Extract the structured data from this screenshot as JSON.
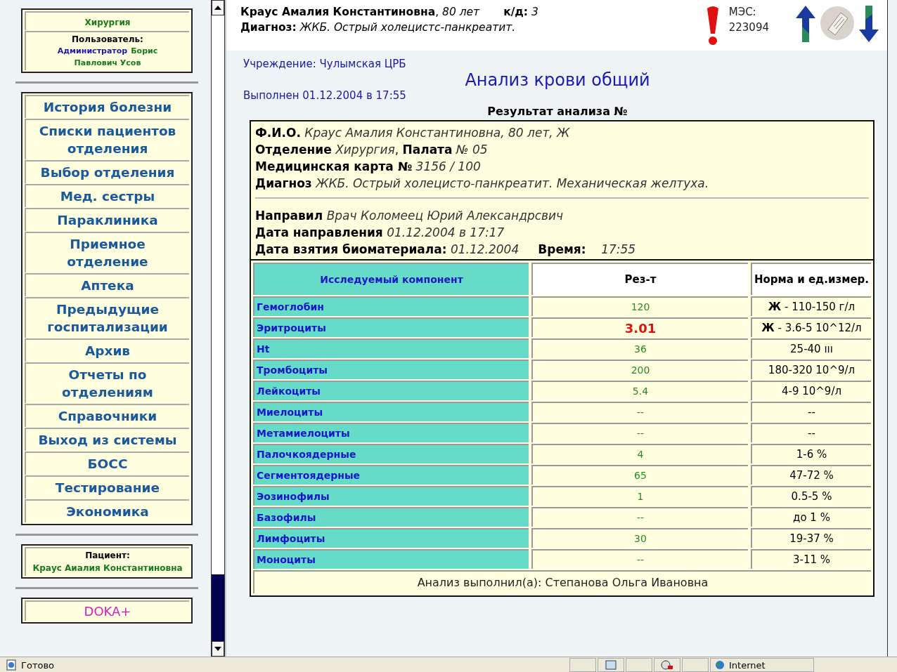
{
  "sidebar": {
    "department": "Хирургия",
    "user_label": "Пользователь:",
    "user_role": "Администратор",
    "user_name": "Борис Павлович Усов",
    "nav_items": [
      {
        "label": "История болезни"
      },
      {
        "label": "Списки пациентов отделения"
      },
      {
        "label": "Выбор отделения"
      },
      {
        "label": "Мед. сестры"
      },
      {
        "label": "Параклиника"
      },
      {
        "label": "Приемное отделение"
      },
      {
        "label": "Аптека"
      },
      {
        "label": "Предыдущие госпитализации"
      },
      {
        "label": "Архив"
      },
      {
        "label": "Отчеты по отделениям"
      },
      {
        "label": "Справочники"
      },
      {
        "label": "Выход из системы"
      },
      {
        "label": "БОСС"
      },
      {
        "label": "Тестирование"
      },
      {
        "label": "Экономика"
      }
    ],
    "patient_label": "Пациент:",
    "patient_name": "Краус Аиалия Константиновна",
    "brand": "DOKA+"
  },
  "header": {
    "patient": "**Краус Амалия Константиновна**, *80 лет*",
    "bed_days": "**к/д:** *3*",
    "diagnosis": "**Диагноз:** *ЖКБ. Острый холецистс-панкреатит.*",
    "mes_label": "МЭС:",
    "mes_code": "223094"
  },
  "report": {
    "institution": "Учреждение: Чулымская ЦРБ",
    "title": "Анализ крови общий",
    "performed": "Выполнен 01.12.2004 в 17:55",
    "result_title": "Результат анализа №",
    "info_lines": [
      "**Ф.И.О.** *Краус Амалия Константиновна, 80 лет, Ж*",
      "**Отделение** *Хирургия*, **Палата** *№ 05*",
      "**Медицинская карта №** *3156 / 100*",
      "**Диагноз** *ЖКБ. Острый холецисто-панкреатит. Механическая желтуха.*"
    ],
    "referral_lines": [
      "**Направил** *Врач Коломеец Юрий Александрсвич*",
      "**Дата направления** *01.12.2004 в 17:17*",
      "**Дата взятия биоматериала:** *01.12.2004*     **Время:**    *17:55*"
    ],
    "columns": [
      "Исследуемый компонент",
      "Рез-т",
      "Норма и ед.измер."
    ],
    "rows": [
      {
        "component": "Гемоглобин",
        "result": "120",
        "abnormal": false,
        "norm": "**Ж** - 110-150 г/л"
      },
      {
        "component": "Эритроциты",
        "result": "3.01",
        "abnormal": true,
        "norm": "**Ж** - 3.6-5 10^12/л"
      },
      {
        "component": "Ht",
        "result": "36",
        "abnormal": false,
        "norm": "25-40 ııı"
      },
      {
        "component": "Тромбоциты",
        "result": "200",
        "abnormal": false,
        "norm": "180-320 10^9/л"
      },
      {
        "component": "Лейкоциты",
        "result": "5.4",
        "abnormal": false,
        "norm": "4-9 10^9/л"
      },
      {
        "component": "Миелоциты",
        "result": "--",
        "abnormal": false,
        "norm": "--"
      },
      {
        "component": "Метамиелоциты",
        "result": "--",
        "abnormal": false,
        "norm": "--"
      },
      {
        "component": "Палочкоядерные",
        "result": "4",
        "abnormal": false,
        "norm": "1-6 %"
      },
      {
        "component": "Сегментоядерные",
        "result": "65",
        "abnormal": false,
        "norm": "47-72 %"
      },
      {
        "component": "Эозинофилы",
        "result": "1",
        "abnormal": false,
        "norm": "0.5-5 %"
      },
      {
        "component": "Базофилы",
        "result": "--",
        "abnormal": false,
        "norm": "до 1 %"
      },
      {
        "component": "Лимфоциты",
        "result": "30",
        "abnormal": false,
        "norm": "19-37 %"
      },
      {
        "component": "Моноциты",
        "result": "--",
        "abnormal": false,
        "norm": "3-11 %"
      }
    ],
    "performed_by": "Анализ выполнил(а): Степанова Ольга Ивановна"
  },
  "status_bar": {
    "status": "Готово",
    "zone": "Internet"
  }
}
